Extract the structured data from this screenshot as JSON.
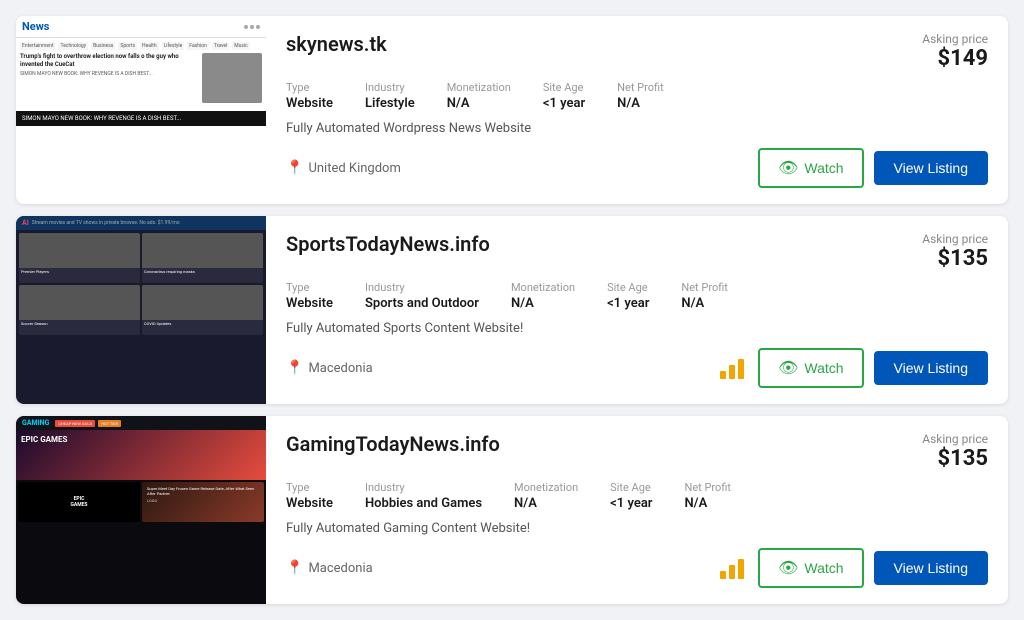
{
  "listings": [
    {
      "id": "listing-1",
      "title": "skynews.tk",
      "asking_price_label": "Asking price",
      "asking_price": "$149",
      "type_label": "Type",
      "type_value": "Website",
      "industry_label": "Industry",
      "industry_value": "Lifestyle",
      "monetization_label": "Monetization",
      "monetization_value": "N/A",
      "site_age_label": "Site Age",
      "site_age_value": "<1 year",
      "net_profit_label": "Net Profit",
      "net_profit_value": "N/A",
      "description": "Fully Automated Wordpress News Website",
      "location": "United Kingdom",
      "watch_label": "Watch",
      "view_label": "View Listing",
      "has_profit_indicator": false
    },
    {
      "id": "listing-2",
      "title": "SportsTodayNews.info",
      "asking_price_label": "Asking price",
      "asking_price": "$135",
      "type_label": "Type",
      "type_value": "Website",
      "industry_label": "Industry",
      "industry_value": "Sports and Outdoor",
      "monetization_label": "Monetization",
      "monetization_value": "N/A",
      "site_age_label": "Site Age",
      "site_age_value": "<1 year",
      "net_profit_label": "Net Profit",
      "net_profit_value": "N/A",
      "description": "Fully Automated Sports Content Website!",
      "location": "Macedonia",
      "watch_label": "Watch",
      "view_label": "View Listing",
      "has_profit_indicator": true
    },
    {
      "id": "listing-3",
      "title": "GamingTodayNews.info",
      "asking_price_label": "Asking price",
      "asking_price": "$135",
      "type_label": "Type",
      "type_value": "Website",
      "industry_label": "Industry",
      "industry_value": "Hobbies and Games",
      "monetization_label": "Monetization",
      "monetization_value": "N/A",
      "site_age_label": "Site Age",
      "site_age_value": "<1 year",
      "net_profit_label": "Net Profit",
      "net_profit_value": "N/A",
      "description": "Fully Automated Gaming Content Website!",
      "location": "Macedonia",
      "watch_label": "Watch",
      "view_label": "View Listing",
      "has_profit_indicator": true
    }
  ]
}
